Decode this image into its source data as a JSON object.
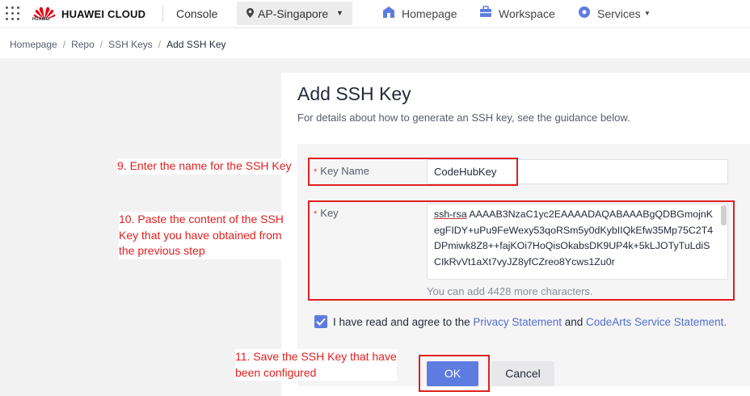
{
  "topbar": {
    "brand": "HUAWEI CLOUD",
    "logo_sub": "HUAWEI",
    "console": "Console",
    "region": "AP-Singapore",
    "homepage": "Homepage",
    "workspace": "Workspace",
    "services": "Services",
    "logo_color": "#e60012"
  },
  "breadcrumb": {
    "items": [
      "Homepage",
      "Repo",
      "SSH Keys"
    ],
    "current": "Add SSH Key"
  },
  "page": {
    "title": "Add SSH Key",
    "subtitle": "For details about how to generate an SSH key, see the guidance below."
  },
  "form": {
    "key_name_label": "Key Name",
    "key_name_value": "CodeHubKey",
    "key_label": "Key",
    "key_first_line": "ssh-rsa",
    "key_value": "AAAAB3NzaC1yc2EAAAADAQABAAABgQDBGmojnKegFIDY+uPu9FeWexy53qoRSm5y0dKybIIQkEfw35Mp75C2T4DPmiwk8Z8++fajKOi7HoQisOkabsDK9UP4k+5kLJOTyTuLdiSCIkRvVt1aXt7vyJZ8yfCZreo8Ycws1Zu0r",
    "char_count": "You can add 4428 more characters.",
    "agree_prefix": "I have read and agree to the",
    "privacy_link": "Privacy Statement",
    "agree_and": "and",
    "service_link": "CodeArts Service Statement.",
    "ok_label": "OK",
    "cancel_label": "Cancel"
  },
  "annotations": {
    "step9": "9. Enter the name for the SSH Key",
    "step10": "10. Paste the content of the SSH Key that you have obtained from the previous step",
    "step11": "11. Save the SSH Key that have been configured"
  },
  "colors": {
    "accent": "#5e7ce0",
    "link": "#526ecc",
    "annotation": "#e02020"
  }
}
